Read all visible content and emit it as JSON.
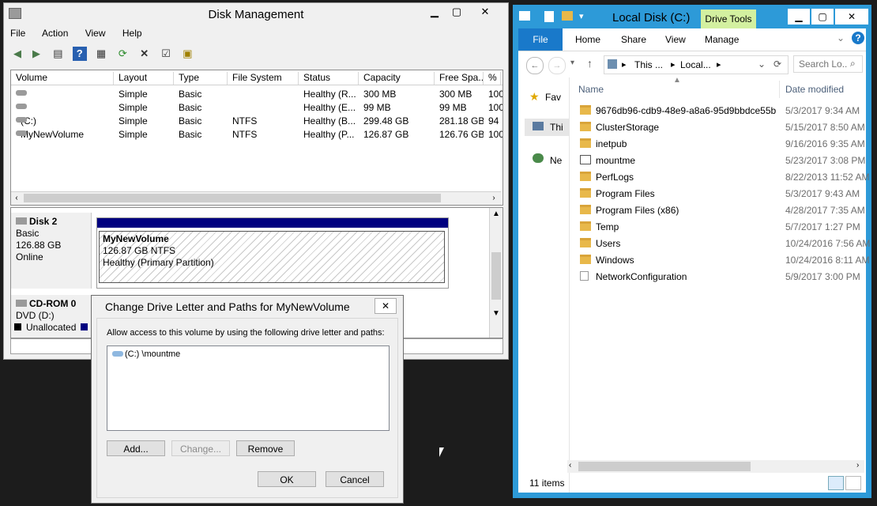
{
  "disk_mgmt": {
    "title": "Disk Management",
    "menu": [
      "File",
      "Action",
      "View",
      "Help"
    ],
    "columns": [
      "Volume",
      "Layout",
      "Type",
      "File System",
      "Status",
      "Capacity",
      "Free Spa...",
      "% F"
    ],
    "rows": [
      [
        "",
        "Simple",
        "Basic",
        "",
        "Healthy (R...",
        "300 MB",
        "300 MB",
        "100"
      ],
      [
        "",
        "Simple",
        "Basic",
        "",
        "Healthy (E...",
        "99 MB",
        "99 MB",
        "100"
      ],
      [
        "(C:)",
        "Simple",
        "Basic",
        "NTFS",
        "Healthy (B...",
        "299.48 GB",
        "281.18 GB",
        "94"
      ],
      [
        "MyNewVolume",
        "Simple",
        "Basic",
        "NTFS",
        "Healthy (P...",
        "126.87 GB",
        "126.76 GB",
        "100"
      ]
    ],
    "disk2": {
      "name": "Disk 2",
      "type": "Basic",
      "size": "126.88 GB",
      "state": "Online",
      "partition_name": "MyNewVolume",
      "partition_size": "126.87 GB NTFS",
      "partition_status": "Healthy (Primary Partition)"
    },
    "cdrom": {
      "name": "CD-ROM 0",
      "drive": "DVD (D:)"
    },
    "legend_unallocated": "Unallocated"
  },
  "dialog": {
    "title": "Change Drive Letter and Paths for MyNewVolume",
    "instruction": "Allow access to this volume by using the following drive letter and paths:",
    "paths": [
      "(C:) \\mountme"
    ],
    "add_label": "Add...",
    "change_label": "Change...",
    "remove_label": "Remove",
    "ok_label": "OK",
    "cancel_label": "Cancel",
    "close_glyph": "✕"
  },
  "explorer": {
    "title": "Local Disk (C:)",
    "context_tab": "Drive Tools",
    "tabs": [
      "File",
      "Home",
      "Share",
      "View",
      "Manage"
    ],
    "address": [
      "This ...",
      "Local..."
    ],
    "search_placeholder": "Search Lo...",
    "col_name": "Name",
    "col_date": "Date modified",
    "nav": [
      "Fav",
      "Thi",
      "Ne"
    ],
    "files": [
      {
        "name": "9676db96-cdb9-48e9-a8a6-95d9bbdce55b",
        "date": "5/3/2017 9:34 AM",
        "kind": "folder"
      },
      {
        "name": "ClusterStorage",
        "date": "5/15/2017 8:50 AM",
        "kind": "folder"
      },
      {
        "name": "inetpub",
        "date": "9/16/2016 9:35 AM",
        "kind": "folder"
      },
      {
        "name": "mountme",
        "date": "5/23/2017 3:08 PM",
        "kind": "mount"
      },
      {
        "name": "PerfLogs",
        "date": "8/22/2013 11:52 AM",
        "kind": "folder"
      },
      {
        "name": "Program Files",
        "date": "5/3/2017 9:43 AM",
        "kind": "folder"
      },
      {
        "name": "Program Files (x86)",
        "date": "4/28/2017 7:35 AM",
        "kind": "folder"
      },
      {
        "name": "Temp",
        "date": "5/7/2017 1:27 PM",
        "kind": "folder"
      },
      {
        "name": "Users",
        "date": "10/24/2016 7:56 AM",
        "kind": "folder"
      },
      {
        "name": "Windows",
        "date": "10/24/2016 8:11 AM",
        "kind": "folder"
      },
      {
        "name": "NetworkConfiguration",
        "date": "5/9/2017 3:00 PM",
        "kind": "file"
      }
    ],
    "item_count": "11 items"
  },
  "colors": {
    "explorer_frame": "#2d9ad8",
    "partition_bar": "#000080",
    "drive_tools_tab": "#d3f0a0",
    "file_tab": "#1979ca"
  }
}
